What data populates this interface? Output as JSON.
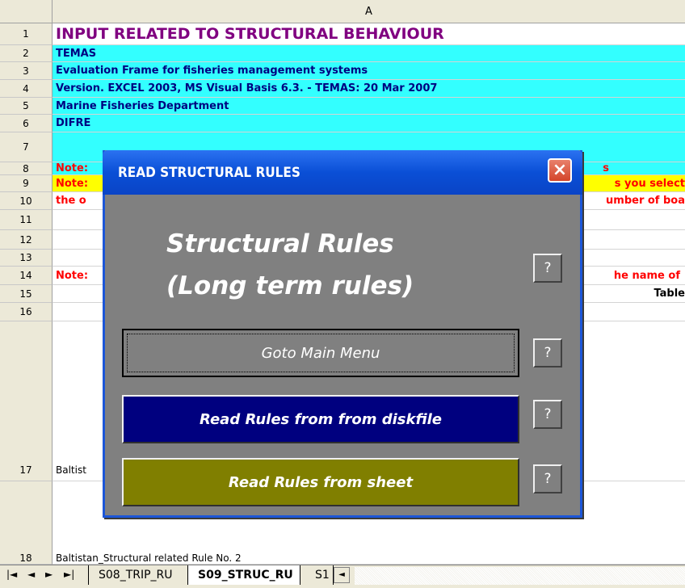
{
  "column_header": "A",
  "rows": [
    {
      "num": "1",
      "text": "INPUT RELATED TO STRUCTURAL BEHAVIOUR"
    },
    {
      "num": "2",
      "text": "TEMAS"
    },
    {
      "num": "3",
      "text": "Evaluation Frame for fisheries management systems"
    },
    {
      "num": "4",
      "text": "Version. EXCEL 2003, MS Visual Basis 6.3. - TEMAS: 20 Mar 2007"
    },
    {
      "num": "5",
      "text": "Marine Fisheries Department"
    },
    {
      "num": "6",
      "text": "DIFRE"
    },
    {
      "num": "7",
      "text": ""
    },
    {
      "num": "8",
      "text": "Note:",
      "right": "s"
    },
    {
      "num": "9",
      "text": "Note:",
      "right": "s you select"
    },
    {
      "num": "10",
      "text": "the o",
      "right": "umber of boa"
    },
    {
      "num": "11",
      "text": ""
    },
    {
      "num": "12",
      "text": ""
    },
    {
      "num": "13",
      "text": ""
    },
    {
      "num": "14",
      "text": "Note:",
      "right": "he name of"
    },
    {
      "num": "15",
      "text": "",
      "right": "Table"
    },
    {
      "num": "16",
      "text": ""
    },
    {
      "num": "17",
      "text": "Baltist"
    },
    {
      "num": "18",
      "text": "Baltistan_Structural related Rule No. 2"
    }
  ],
  "dialog": {
    "title": "READ STRUCTURAL  RULES",
    "close_label": "×",
    "heading_line1": "Structural Rules",
    "heading_line2": "(Long term rules)",
    "help_label": "?",
    "buttons": {
      "goto": "Goto Main Menu",
      "disk": "Read  Rules  from from diskfile",
      "sheet": "Read  Rules  from sheet"
    }
  },
  "tabs": {
    "nav_first": "|◄",
    "nav_prev": "◄",
    "nav_next": "►",
    "nav_last": "►|",
    "items": [
      "S08_TRIP_RU",
      "S09_STRUC_RU",
      "S1"
    ],
    "active": "S09_STRUC_RU",
    "scroll_left": "◄"
  },
  "colors": {
    "cyan": "#33ffff",
    "note_yellow": "#ffff00",
    "title_red": "#800080",
    "navy": "#00007f",
    "olive": "#807f00",
    "dialog_gray": "#808080"
  }
}
